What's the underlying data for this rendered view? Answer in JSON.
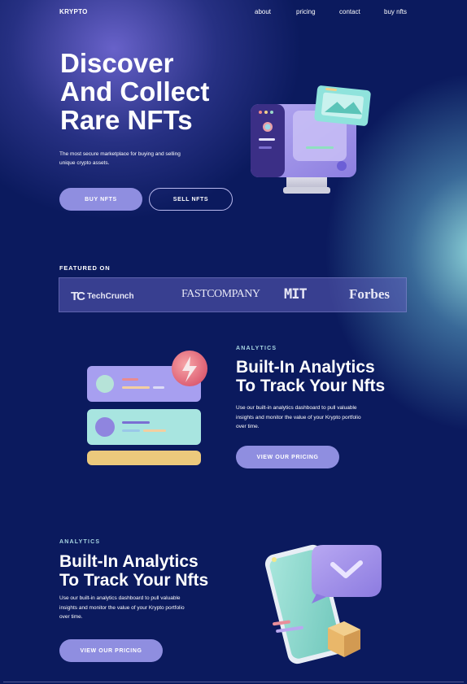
{
  "nav": {
    "logo": "KRYPTO",
    "links": [
      "about",
      "pricing",
      "contact",
      "buy nfts"
    ]
  },
  "hero": {
    "title_line1": "Discover",
    "title_line2": "And Collect",
    "title_line3": "Rare NFTs",
    "subtitle": "The most secure marketplace for buying and selling unique crypto assets.",
    "buy_label": "BUY NFTS",
    "sell_label": "SELL NFTS"
  },
  "featured": {
    "label": "FEATURED ON",
    "brands": [
      "TechCrunch",
      "FASTCOMPANY",
      "MIT",
      "Forbes"
    ]
  },
  "section1": {
    "eyebrow": "ANALYTICS",
    "title_line1": "Built-In Analytics",
    "title_line2": "To Track Your Nfts",
    "description": "Use our built-in analytics dashboard to pull valuable insights and monitor the value of your Krypto portfolio over time.",
    "cta": "VIEW OUR PRICING"
  },
  "section2": {
    "eyebrow": "ANALYTICS",
    "title_line1": "Built-In Analytics",
    "title_line2": "To Track Your Nfts",
    "description": "Use our built-in analytics dashboard to pull valuable insights and monitor the value of your Krypto portfolio over time.",
    "cta": "VIEW OUR PRICING"
  },
  "colors": {
    "background": "#0b1a5e",
    "accent": "#8f8ee0",
    "eyebrow": "#a9d7e3",
    "teal_glow": "#96e1e1"
  },
  "icons": {
    "hero": "computer-monitor-illustration",
    "section1": "analytics-cards-illustration",
    "section2": "phone-chat-illustration",
    "techcrunch": "techcrunch-logo"
  }
}
